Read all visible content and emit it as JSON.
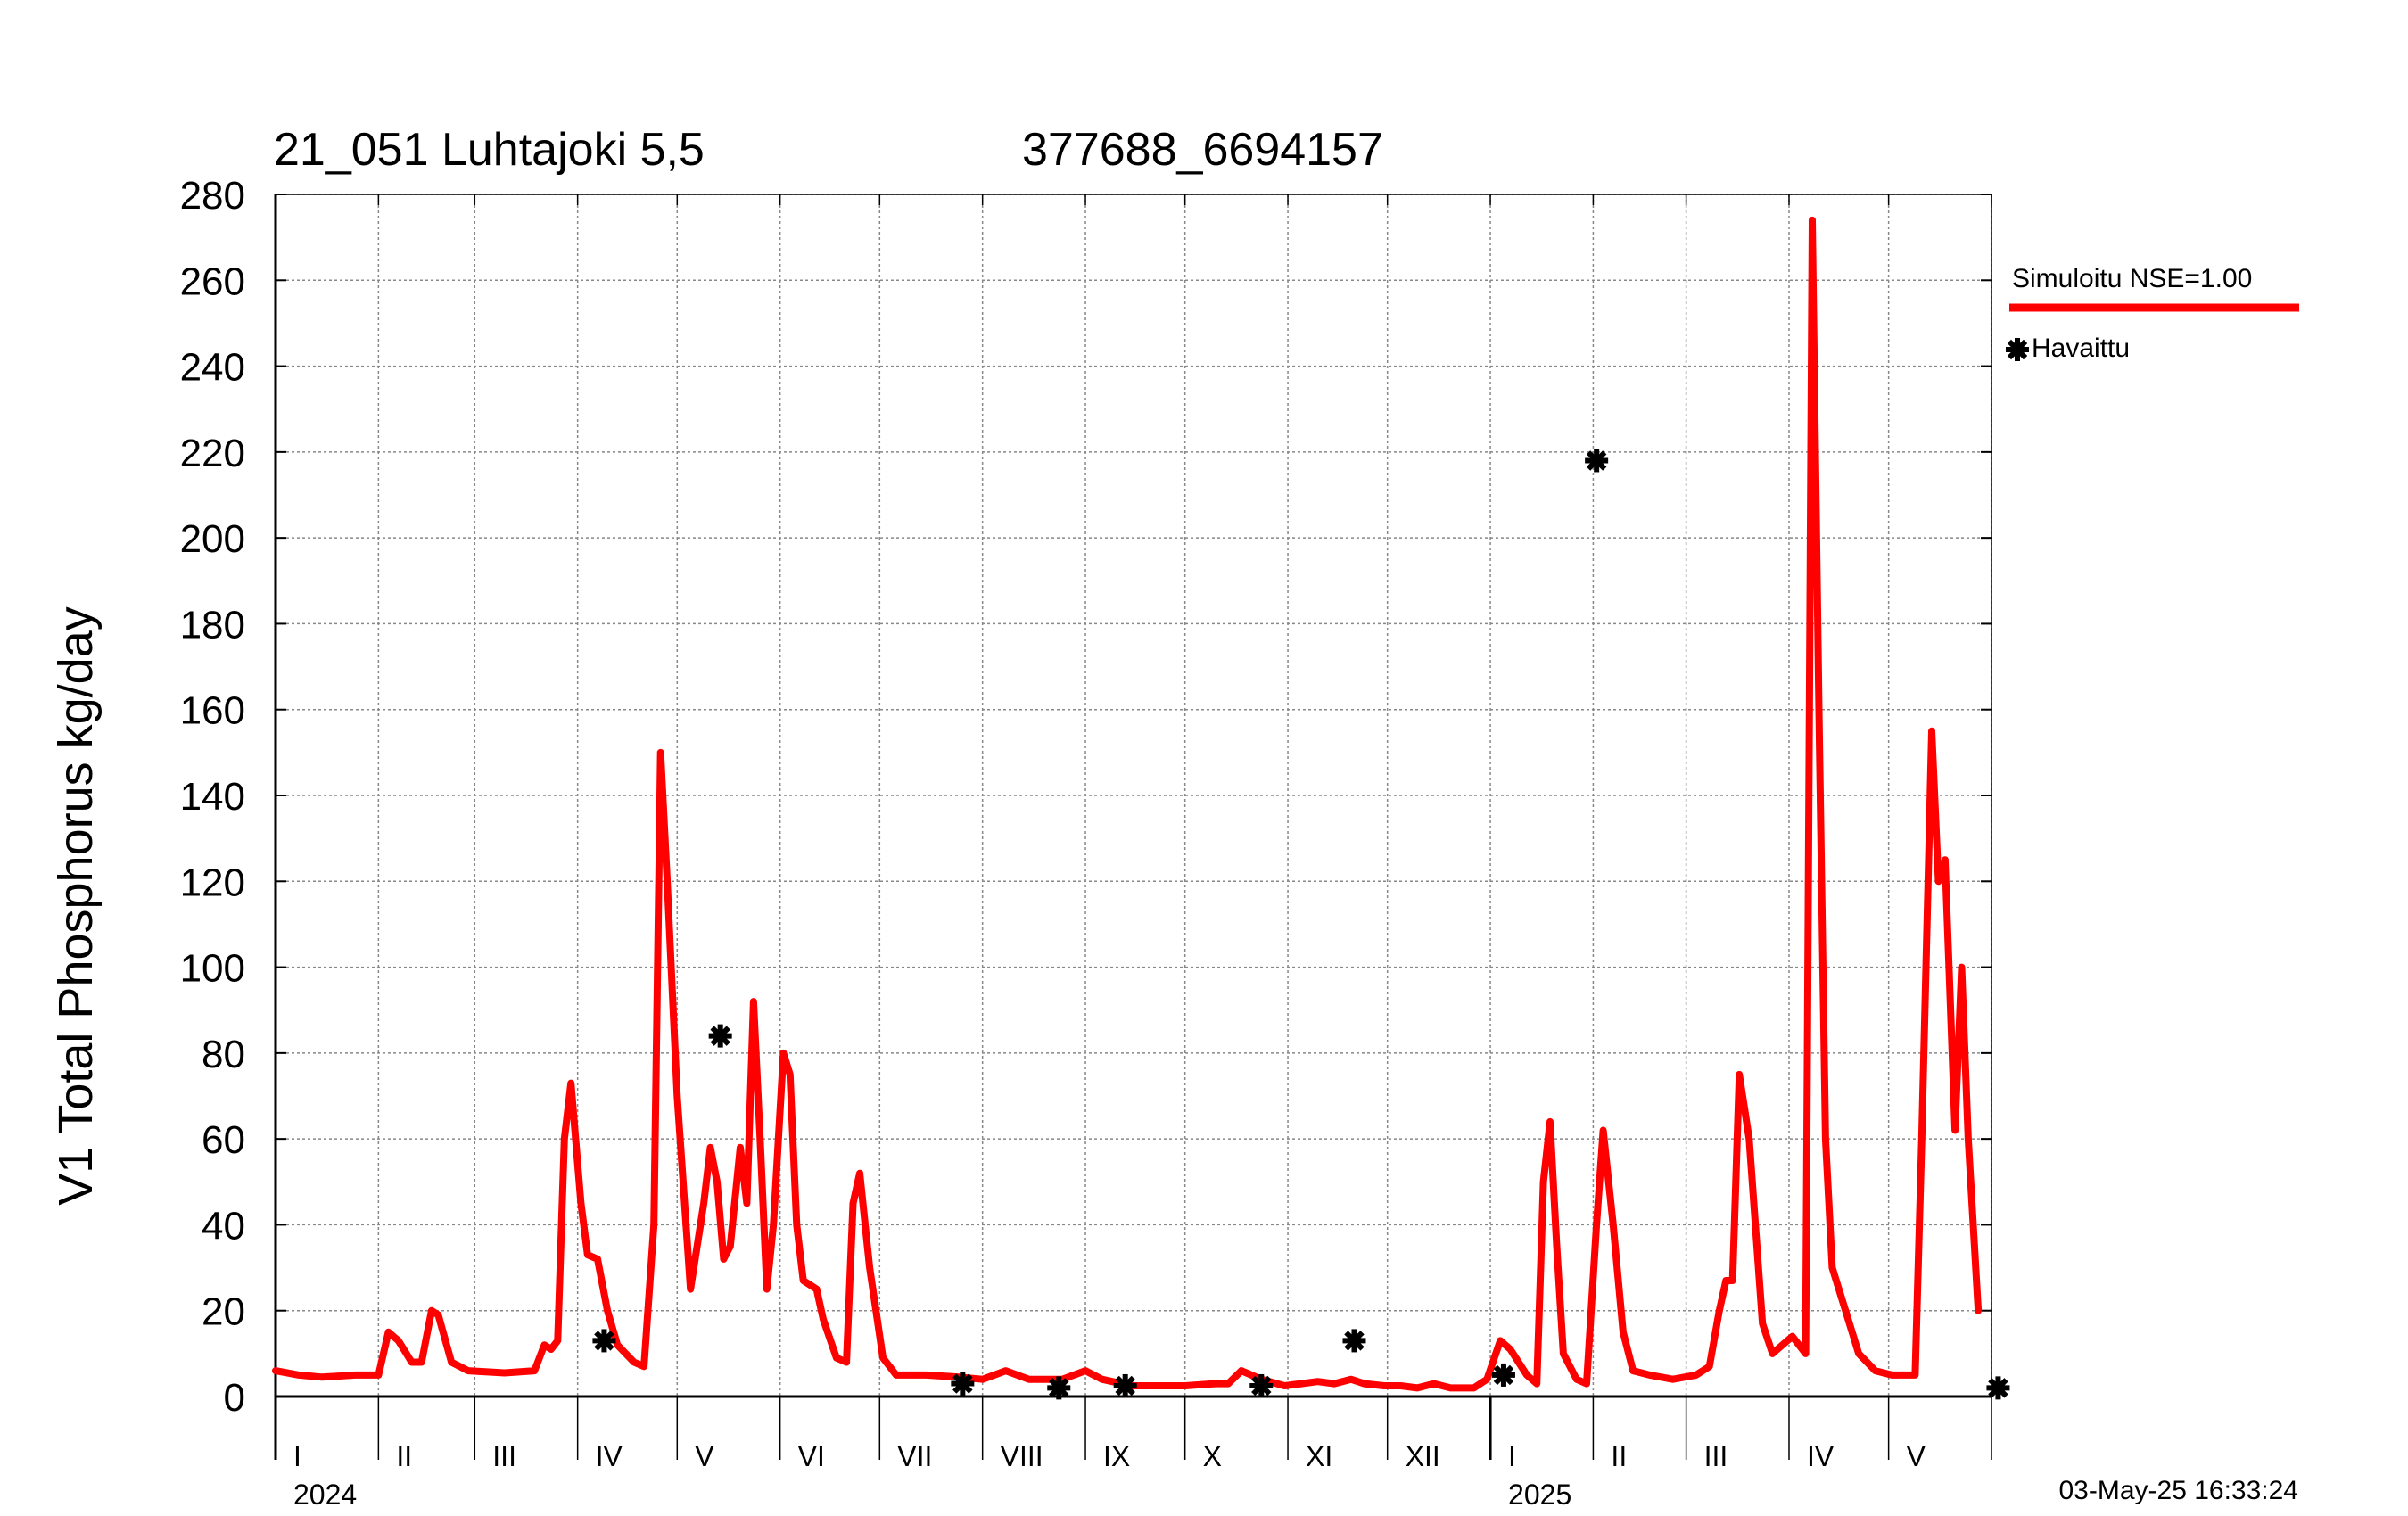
{
  "title": "21_051 Luhtajoki 5,5",
  "station_code": "377688_6694157",
  "timestamp": "03-May-25 16:33:24",
  "chart_data": {
    "type": "line",
    "title": "21_051 Luhtajoki 5,5",
    "xlabel": "",
    "ylabel": "V1 Total Phosphorus kg/day",
    "ylim": [
      0,
      280
    ],
    "y_ticks": [
      0,
      20,
      40,
      60,
      80,
      100,
      120,
      140,
      160,
      180,
      200,
      220,
      240,
      260,
      280
    ],
    "x_range": [
      "2024-01-01",
      "2025-06-01"
    ],
    "month_labels": [
      "I",
      "II",
      "III",
      "IV",
      "V",
      "VI",
      "VII",
      "VIII",
      "IX",
      "X",
      "XI",
      "XII",
      "I",
      "II",
      "III",
      "IV",
      "V"
    ],
    "year_labels": [
      {
        "label": "2024",
        "month_index": 0
      },
      {
        "label": "2025",
        "month_index": 12
      }
    ],
    "grid": true,
    "legend_position": "right",
    "colors": {
      "simulated": "#ff0000",
      "observed": "#000000",
      "grid": "#888888"
    },
    "series": [
      {
        "name": "Simuloitu NSE=1.00",
        "style": "line",
        "points": [
          [
            "2024-01-01",
            6
          ],
          [
            "2024-01-08",
            5
          ],
          [
            "2024-01-15",
            4.5
          ],
          [
            "2024-01-25",
            5
          ],
          [
            "2024-02-01",
            5
          ],
          [
            "2024-02-04",
            15
          ],
          [
            "2024-02-07",
            13
          ],
          [
            "2024-02-11",
            8
          ],
          [
            "2024-02-14",
            8
          ],
          [
            "2024-02-17",
            20
          ],
          [
            "2024-02-19",
            19
          ],
          [
            "2024-02-23",
            8
          ],
          [
            "2024-02-28",
            6
          ],
          [
            "2024-03-10",
            5.5
          ],
          [
            "2024-03-19",
            6
          ],
          [
            "2024-03-22",
            12
          ],
          [
            "2024-03-24",
            11
          ],
          [
            "2024-03-26",
            13
          ],
          [
            "2024-03-28",
            60
          ],
          [
            "2024-03-30",
            73
          ],
          [
            "2024-04-02",
            45
          ],
          [
            "2024-04-04",
            33
          ],
          [
            "2024-04-07",
            32
          ],
          [
            "2024-04-10",
            20
          ],
          [
            "2024-04-13",
            12
          ],
          [
            "2024-04-18",
            8
          ],
          [
            "2024-04-21",
            7
          ],
          [
            "2024-04-24",
            40
          ],
          [
            "2024-04-26",
            150
          ],
          [
            "2024-04-28",
            120
          ],
          [
            "2024-05-01",
            70
          ],
          [
            "2024-05-05",
            25
          ],
          [
            "2024-05-09",
            45
          ],
          [
            "2024-05-11",
            58
          ],
          [
            "2024-05-13",
            50
          ],
          [
            "2024-05-15",
            32
          ],
          [
            "2024-05-17",
            35
          ],
          [
            "2024-05-20",
            58
          ],
          [
            "2024-05-22",
            45
          ],
          [
            "2024-05-24",
            92
          ],
          [
            "2024-05-26",
            60
          ],
          [
            "2024-05-28",
            25
          ],
          [
            "2024-05-30",
            40
          ],
          [
            "2024-06-02",
            80
          ],
          [
            "2024-06-04",
            75
          ],
          [
            "2024-06-06",
            40
          ],
          [
            "2024-06-08",
            27
          ],
          [
            "2024-06-12",
            25
          ],
          [
            "2024-06-14",
            18
          ],
          [
            "2024-06-18",
            9
          ],
          [
            "2024-06-21",
            8
          ],
          [
            "2024-06-23",
            45
          ],
          [
            "2024-06-25",
            52
          ],
          [
            "2024-06-28",
            30
          ],
          [
            "2024-07-02",
            9
          ],
          [
            "2024-07-06",
            5
          ],
          [
            "2024-07-15",
            5
          ],
          [
            "2024-07-25",
            4.5
          ],
          [
            "2024-08-01",
            4
          ],
          [
            "2024-08-08",
            6
          ],
          [
            "2024-08-15",
            4
          ],
          [
            "2024-08-25",
            4
          ],
          [
            "2024-09-01",
            6
          ],
          [
            "2024-09-06",
            4
          ],
          [
            "2024-09-15",
            2.5
          ],
          [
            "2024-09-30",
            2.5
          ],
          [
            "2024-10-01",
            2.5
          ],
          [
            "2024-10-10",
            3
          ],
          [
            "2024-10-14",
            3
          ],
          [
            "2024-10-18",
            6
          ],
          [
            "2024-10-24",
            4
          ],
          [
            "2024-10-31",
            2.5
          ],
          [
            "2024-11-05",
            3
          ],
          [
            "2024-11-10",
            3.5
          ],
          [
            "2024-11-15",
            3
          ],
          [
            "2024-11-20",
            4
          ],
          [
            "2024-11-24",
            3
          ],
          [
            "2024-11-30",
            2.5
          ],
          [
            "2024-12-05",
            2.5
          ],
          [
            "2024-12-10",
            2
          ],
          [
            "2024-12-15",
            3
          ],
          [
            "2024-12-20",
            2
          ],
          [
            "2024-12-27",
            2
          ],
          [
            "2024-12-31",
            4
          ],
          [
            "2025-01-04",
            13
          ],
          [
            "2025-01-07",
            11
          ],
          [
            "2025-01-12",
            5
          ],
          [
            "2025-01-15",
            3
          ],
          [
            "2025-01-17",
            50
          ],
          [
            "2025-01-19",
            64
          ],
          [
            "2025-01-21",
            35
          ],
          [
            "2025-01-23",
            10
          ],
          [
            "2025-01-27",
            4
          ],
          [
            "2025-01-30",
            3
          ],
          [
            "2025-02-02",
            40
          ],
          [
            "2025-02-04",
            62
          ],
          [
            "2025-02-07",
            40
          ],
          [
            "2025-02-10",
            15
          ],
          [
            "2025-02-13",
            6
          ],
          [
            "2025-02-18",
            5
          ],
          [
            "2025-02-25",
            4
          ],
          [
            "2025-03-04",
            5
          ],
          [
            "2025-03-08",
            7
          ],
          [
            "2025-03-11",
            20
          ],
          [
            "2025-03-13",
            27
          ],
          [
            "2025-03-15",
            27
          ],
          [
            "2025-03-17",
            75
          ],
          [
            "2025-03-20",
            60
          ],
          [
            "2025-03-24",
            17
          ],
          [
            "2025-03-27",
            10
          ],
          [
            "2025-03-30",
            12
          ],
          [
            "2025-04-02",
            14
          ],
          [
            "2025-04-06",
            10
          ],
          [
            "2025-04-08",
            274
          ],
          [
            "2025-04-10",
            160
          ],
          [
            "2025-04-12",
            60
          ],
          [
            "2025-04-14",
            30
          ],
          [
            "2025-04-18",
            20
          ],
          [
            "2025-04-22",
            10
          ],
          [
            "2025-04-27",
            6
          ],
          [
            "2025-05-02",
            5
          ],
          [
            "2025-05-09",
            5
          ],
          [
            "2025-05-11",
            60
          ],
          [
            "2025-05-14",
            155
          ],
          [
            "2025-05-16",
            120
          ],
          [
            "2025-05-18",
            125
          ],
          [
            "2025-05-21",
            62
          ],
          [
            "2025-05-23",
            100
          ],
          [
            "2025-05-25",
            60
          ],
          [
            "2025-05-28",
            20
          ]
        ]
      },
      {
        "name": "Havaittu",
        "style": "marker",
        "points": [
          [
            "2024-04-09",
            13
          ],
          [
            "2024-05-14",
            84
          ],
          [
            "2024-07-26",
            3
          ],
          [
            "2024-08-24",
            2
          ],
          [
            "2024-09-13",
            2.5
          ],
          [
            "2024-10-24",
            2.5
          ],
          [
            "2024-11-21",
            13
          ],
          [
            "2025-01-05",
            5
          ],
          [
            "2025-02-02",
            218
          ],
          [
            "2025-06-03",
            2
          ]
        ]
      }
    ]
  }
}
